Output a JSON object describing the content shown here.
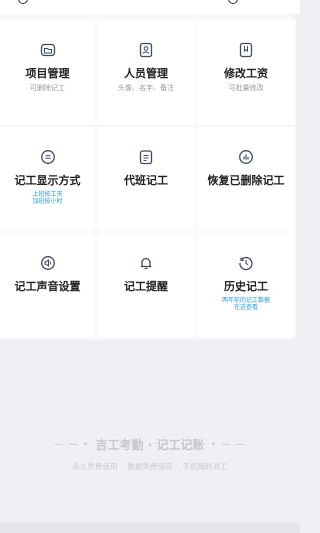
{
  "colors": {
    "icon": "#3d4b63",
    "accent_blue": "#1e9bf0",
    "background": "#eef0f3"
  },
  "grid": [
    {
      "label": "项目管理",
      "sub": "可删除记工",
      "icon": "folder-icon",
      "sub_style": "gray"
    },
    {
      "label": "人员管理",
      "sub": "头像、名字、备注",
      "icon": "contact-card-icon",
      "sub_style": "gray"
    },
    {
      "label": "修改工资",
      "sub": "可批量修改",
      "icon": "bookmark-icon",
      "sub_style": "gray"
    },
    {
      "label": "记工显示方式",
      "sub": "上班按工天\n加班按小时",
      "icon": "list-circle-icon",
      "sub_style": "blue"
    },
    {
      "label": "代班记工",
      "sub": "",
      "icon": "calendar-icon",
      "sub_style": "gray"
    },
    {
      "label": "恢复已删除记工",
      "sub": "",
      "icon": "restore-icon",
      "sub_style": "gray"
    },
    {
      "label": "记工声音设置",
      "sub": "",
      "icon": "speaker-icon",
      "sub_style": "gray"
    },
    {
      "label": "记工提醒",
      "sub": "",
      "icon": "bell-icon",
      "sub_style": "gray"
    },
    {
      "label": "历史记工",
      "sub": "两年前的记工数据\n在这查看",
      "icon": "history-icon",
      "sub_style": "blue"
    }
  ],
  "footer": {
    "brand": "吉工考勤 · 记工记账",
    "slogans": [
      "永久免费使用",
      "数据免费保存",
      "手机随时对工"
    ]
  }
}
